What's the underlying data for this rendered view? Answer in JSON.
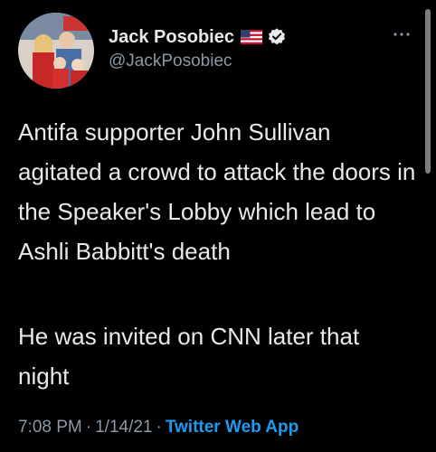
{
  "tweet": {
    "author": {
      "display_name": "Jack Posobiec",
      "handle": "@JackPosobiec",
      "flag_icon": "us-flag-icon",
      "verified_icon": "verified-badge-icon"
    },
    "more_icon": "more-options-icon",
    "paragraphs": [
      "Antifa supporter John Sullivan agitated a crowd to attack the doors in the Speaker's Lobby which lead to Ashli Babbitt's death",
      "He was invited on CNN later that night"
    ],
    "meta": {
      "time": "7:08 PM",
      "separator": "·",
      "date": "1/14/21",
      "source": "Twitter Web App"
    }
  },
  "colors": {
    "background": "#000000",
    "text": "#e7e9ea",
    "secondary_text": "#8b98a5",
    "link": "#1d9bf0",
    "verified": "#e7e9ea"
  }
}
